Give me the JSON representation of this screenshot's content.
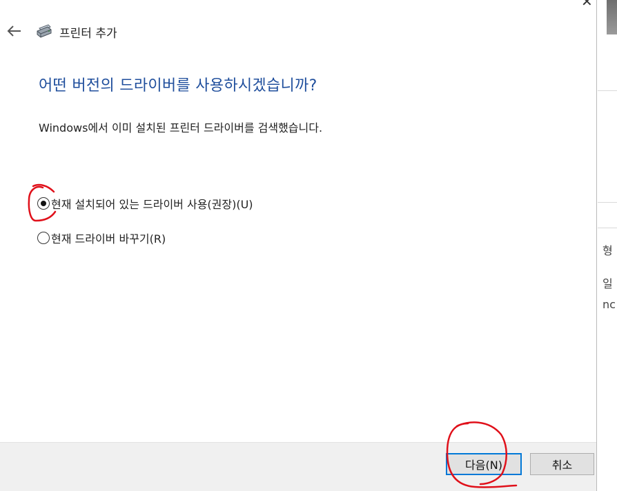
{
  "window": {
    "title": "프린터 추가",
    "close_glyph": "✕"
  },
  "page": {
    "heading": "어떤 버전의 드라이버를 사용하시겠습니까?",
    "description": "Windows에서 이미 설치된 프린터 드라이버를 검색했습니다."
  },
  "options": [
    {
      "label": "현재 설치되어 있는 드라이버 사용(권장)(U)",
      "selected": true
    },
    {
      "label": "현재 드라이버 바꾸기(R)",
      "selected": false
    }
  ],
  "buttons": {
    "next_label": "다음(N)",
    "cancel_label": "취소"
  },
  "background_window": {
    "texts": [
      "형",
      "일",
      "nc"
    ]
  },
  "colors": {
    "heading": "#1f4e9c",
    "primary_border": "#0078d7",
    "annotation": "#e0101a"
  },
  "icons": {
    "back": "back-arrow-icon",
    "printer": "printer-icon",
    "close": "close-icon"
  }
}
